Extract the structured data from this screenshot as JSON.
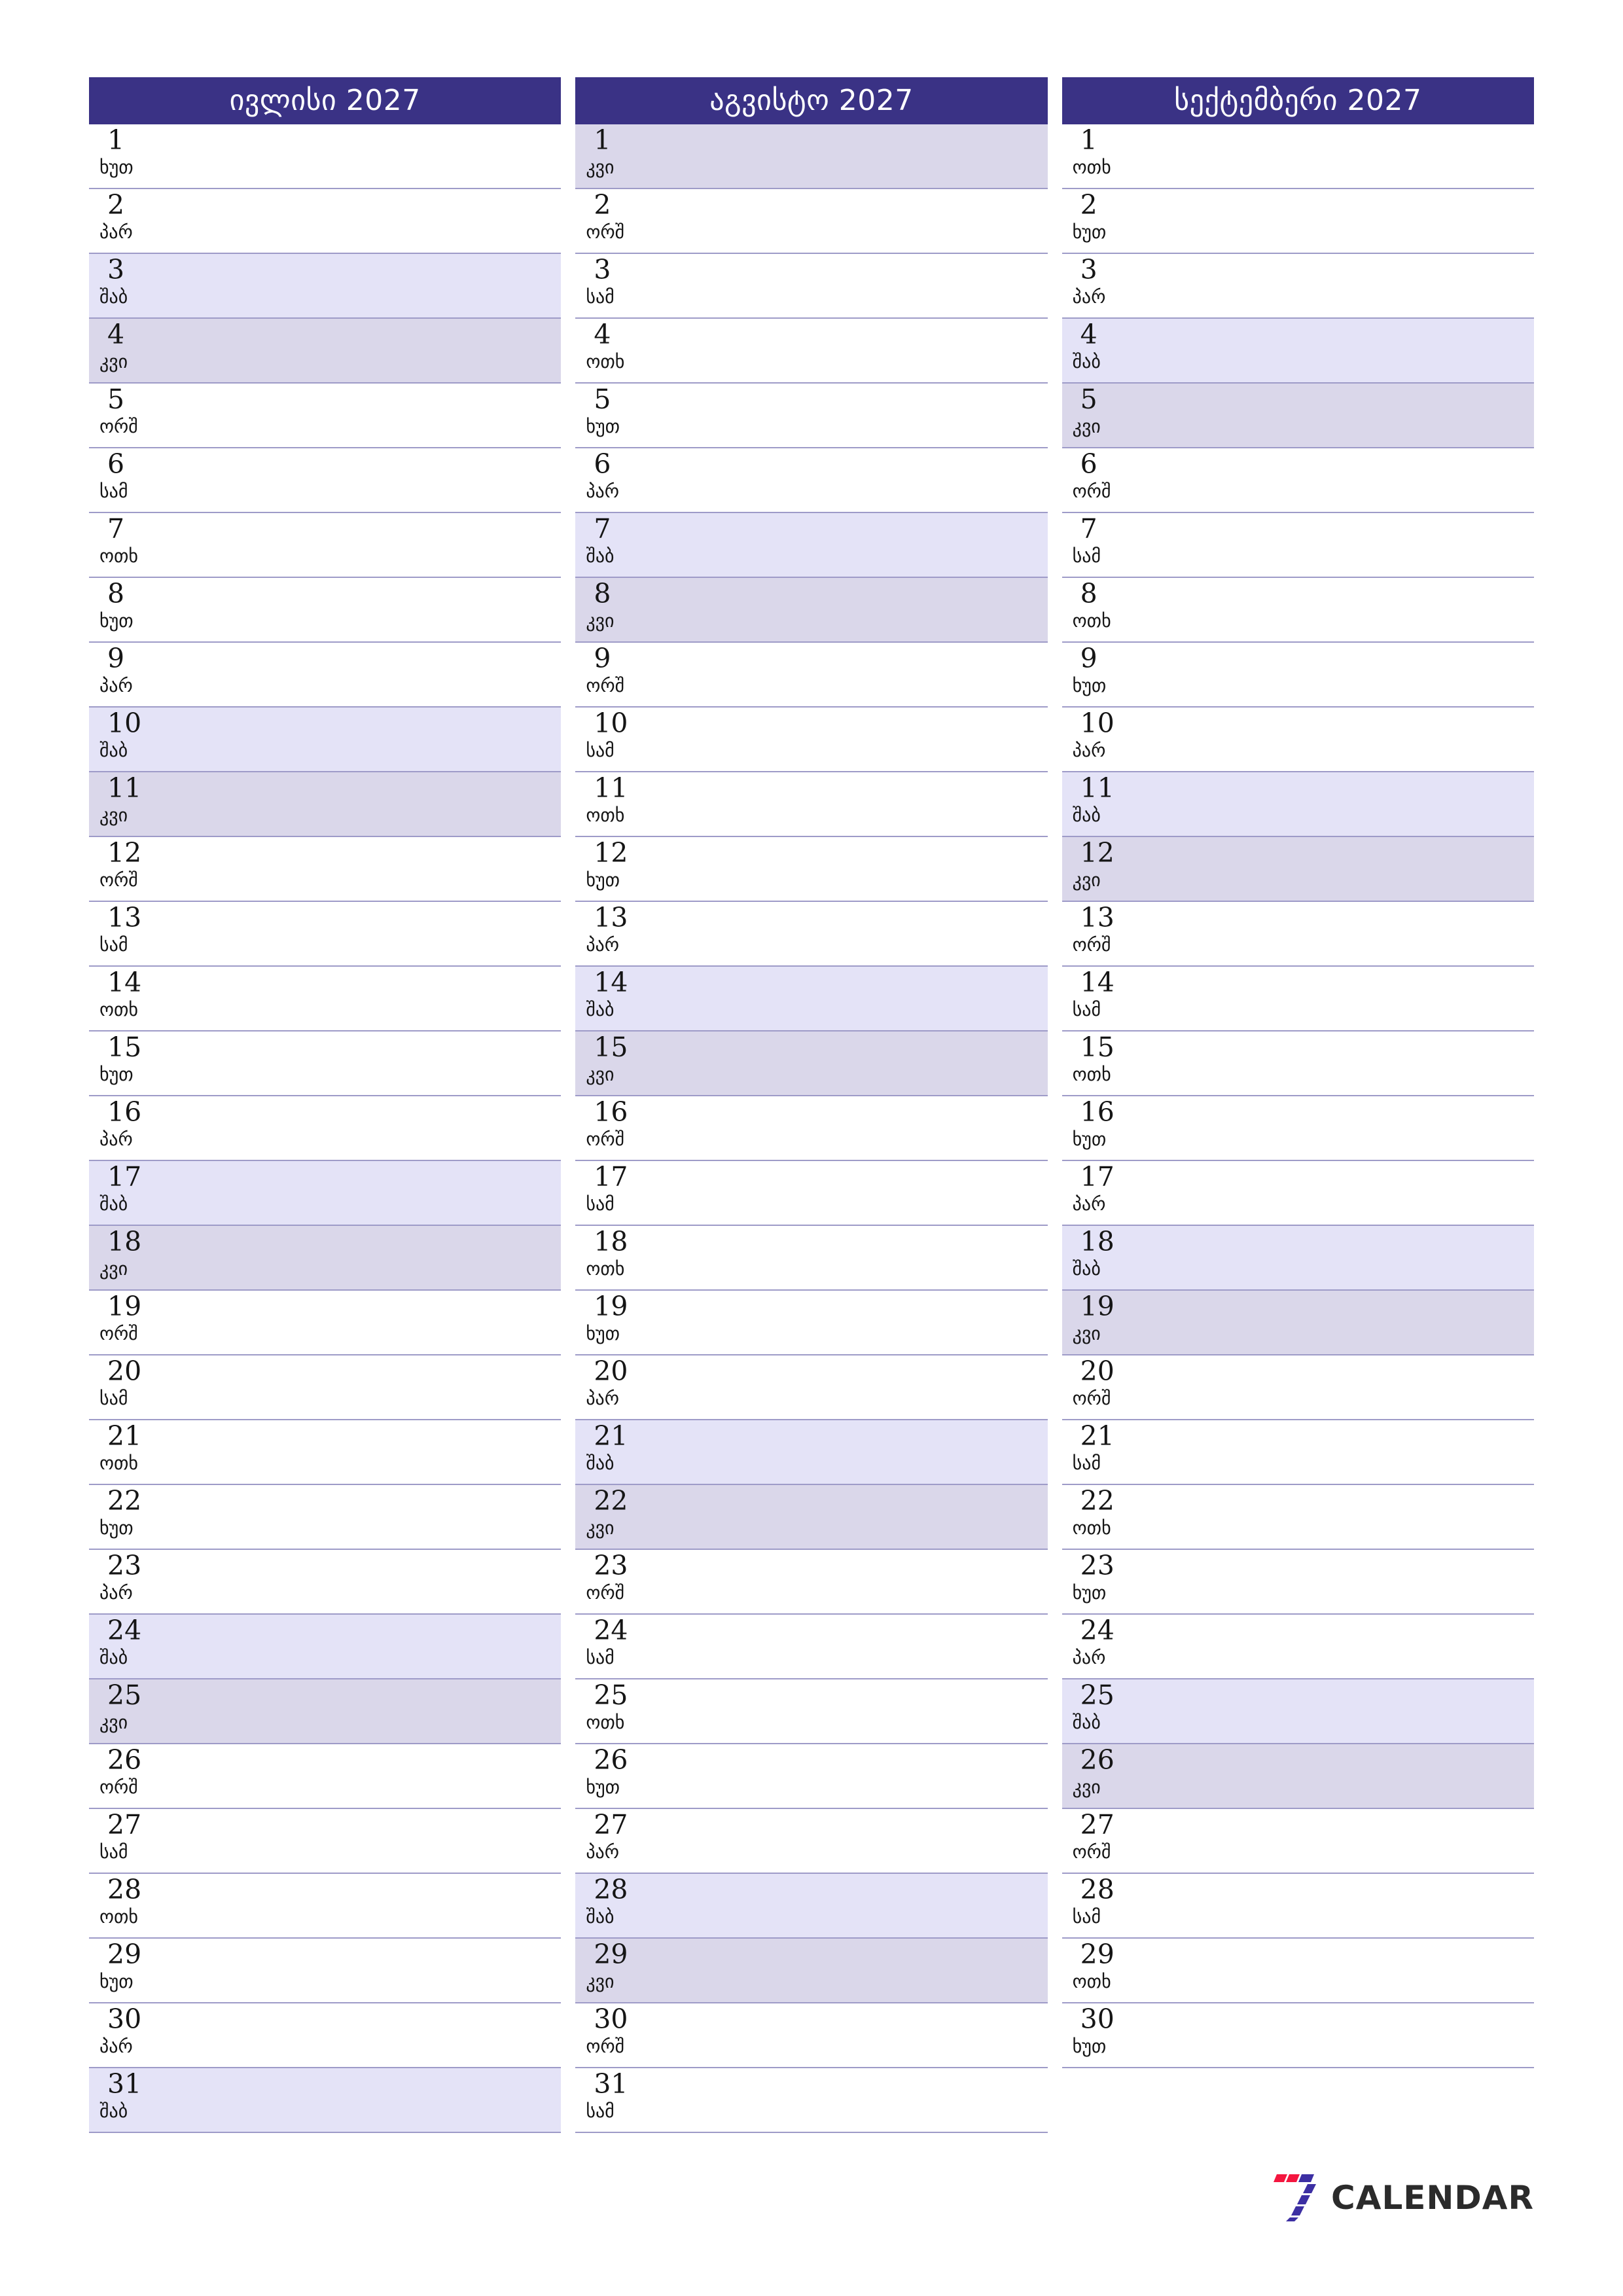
{
  "document": {
    "type": "quarterly-planner",
    "year": "2027",
    "language": "Georgian"
  },
  "colors": {
    "header_bg": "#3a3285",
    "header_text": "#ffffff",
    "saturday_bg": "#e4e3f7",
    "sunday_bg": "#dad7ea",
    "row_border": "#9e9bc8",
    "page_bg": "#ffffff",
    "logo_red": "#f4163f",
    "logo_purple": "#3c2fa3",
    "logo_text": "#2b2b2b"
  },
  "weekday_names": {
    "mon": "ორშ",
    "tue": "სამ",
    "wed": "ოთხ",
    "thu": "ხუთ",
    "fri": "პარ",
    "sat": "შაბ",
    "sun": "კვი"
  },
  "months": [
    {
      "title": "ივლისი 2027",
      "name": "ივლისი",
      "year": "2027",
      "days": [
        {
          "num": "1",
          "dow": "ხუთ",
          "type": "weekday"
        },
        {
          "num": "2",
          "dow": "პარ",
          "type": "weekday"
        },
        {
          "num": "3",
          "dow": "შაბ",
          "type": "sat"
        },
        {
          "num": "4",
          "dow": "კვი",
          "type": "sun"
        },
        {
          "num": "5",
          "dow": "ორშ",
          "type": "weekday"
        },
        {
          "num": "6",
          "dow": "სამ",
          "type": "weekday"
        },
        {
          "num": "7",
          "dow": "ოთხ",
          "type": "weekday"
        },
        {
          "num": "8",
          "dow": "ხუთ",
          "type": "weekday"
        },
        {
          "num": "9",
          "dow": "პარ",
          "type": "weekday"
        },
        {
          "num": "10",
          "dow": "შაბ",
          "type": "sat"
        },
        {
          "num": "11",
          "dow": "კვი",
          "type": "sun"
        },
        {
          "num": "12",
          "dow": "ორშ",
          "type": "weekday"
        },
        {
          "num": "13",
          "dow": "სამ",
          "type": "weekday"
        },
        {
          "num": "14",
          "dow": "ოთხ",
          "type": "weekday"
        },
        {
          "num": "15",
          "dow": "ხუთ",
          "type": "weekday"
        },
        {
          "num": "16",
          "dow": "პარ",
          "type": "weekday"
        },
        {
          "num": "17",
          "dow": "შაბ",
          "type": "sat"
        },
        {
          "num": "18",
          "dow": "კვი",
          "type": "sun"
        },
        {
          "num": "19",
          "dow": "ორშ",
          "type": "weekday"
        },
        {
          "num": "20",
          "dow": "სამ",
          "type": "weekday"
        },
        {
          "num": "21",
          "dow": "ოთხ",
          "type": "weekday"
        },
        {
          "num": "22",
          "dow": "ხუთ",
          "type": "weekday"
        },
        {
          "num": "23",
          "dow": "პარ",
          "type": "weekday"
        },
        {
          "num": "24",
          "dow": "შაბ",
          "type": "sat"
        },
        {
          "num": "25",
          "dow": "კვი",
          "type": "sun"
        },
        {
          "num": "26",
          "dow": "ორშ",
          "type": "weekday"
        },
        {
          "num": "27",
          "dow": "სამ",
          "type": "weekday"
        },
        {
          "num": "28",
          "dow": "ოთხ",
          "type": "weekday"
        },
        {
          "num": "29",
          "dow": "ხუთ",
          "type": "weekday"
        },
        {
          "num": "30",
          "dow": "პარ",
          "type": "weekday"
        },
        {
          "num": "31",
          "dow": "შაბ",
          "type": "sat"
        }
      ]
    },
    {
      "title": "აგვისტო 2027",
      "name": "აგვისტო",
      "year": "2027",
      "days": [
        {
          "num": "1",
          "dow": "კვი",
          "type": "sun"
        },
        {
          "num": "2",
          "dow": "ორშ",
          "type": "weekday"
        },
        {
          "num": "3",
          "dow": "სამ",
          "type": "weekday"
        },
        {
          "num": "4",
          "dow": "ოთხ",
          "type": "weekday"
        },
        {
          "num": "5",
          "dow": "ხუთ",
          "type": "weekday"
        },
        {
          "num": "6",
          "dow": "პარ",
          "type": "weekday"
        },
        {
          "num": "7",
          "dow": "შაბ",
          "type": "sat"
        },
        {
          "num": "8",
          "dow": "კვი",
          "type": "sun"
        },
        {
          "num": "9",
          "dow": "ორშ",
          "type": "weekday"
        },
        {
          "num": "10",
          "dow": "სამ",
          "type": "weekday"
        },
        {
          "num": "11",
          "dow": "ოთხ",
          "type": "weekday"
        },
        {
          "num": "12",
          "dow": "ხუთ",
          "type": "weekday"
        },
        {
          "num": "13",
          "dow": "პარ",
          "type": "weekday"
        },
        {
          "num": "14",
          "dow": "შაბ",
          "type": "sat"
        },
        {
          "num": "15",
          "dow": "კვი",
          "type": "sun"
        },
        {
          "num": "16",
          "dow": "ორშ",
          "type": "weekday"
        },
        {
          "num": "17",
          "dow": "სამ",
          "type": "weekday"
        },
        {
          "num": "18",
          "dow": "ოთხ",
          "type": "weekday"
        },
        {
          "num": "19",
          "dow": "ხუთ",
          "type": "weekday"
        },
        {
          "num": "20",
          "dow": "პარ",
          "type": "weekday"
        },
        {
          "num": "21",
          "dow": "შაბ",
          "type": "sat"
        },
        {
          "num": "22",
          "dow": "კვი",
          "type": "sun"
        },
        {
          "num": "23",
          "dow": "ორშ",
          "type": "weekday"
        },
        {
          "num": "24",
          "dow": "სამ",
          "type": "weekday"
        },
        {
          "num": "25",
          "dow": "ოთხ",
          "type": "weekday"
        },
        {
          "num": "26",
          "dow": "ხუთ",
          "type": "weekday"
        },
        {
          "num": "27",
          "dow": "პარ",
          "type": "weekday"
        },
        {
          "num": "28",
          "dow": "შაბ",
          "type": "sat"
        },
        {
          "num": "29",
          "dow": "კვი",
          "type": "sun"
        },
        {
          "num": "30",
          "dow": "ორშ",
          "type": "weekday"
        },
        {
          "num": "31",
          "dow": "სამ",
          "type": "weekday"
        }
      ]
    },
    {
      "title": "სექტემბერი 2027",
      "name": "სექტემბერი",
      "year": "2027",
      "days": [
        {
          "num": "1",
          "dow": "ოთხ",
          "type": "weekday"
        },
        {
          "num": "2",
          "dow": "ხუთ",
          "type": "weekday"
        },
        {
          "num": "3",
          "dow": "პარ",
          "type": "weekday"
        },
        {
          "num": "4",
          "dow": "შაბ",
          "type": "sat"
        },
        {
          "num": "5",
          "dow": "კვი",
          "type": "sun"
        },
        {
          "num": "6",
          "dow": "ორშ",
          "type": "weekday"
        },
        {
          "num": "7",
          "dow": "სამ",
          "type": "weekday"
        },
        {
          "num": "8",
          "dow": "ოთხ",
          "type": "weekday"
        },
        {
          "num": "9",
          "dow": "ხუთ",
          "type": "weekday"
        },
        {
          "num": "10",
          "dow": "პარ",
          "type": "weekday"
        },
        {
          "num": "11",
          "dow": "შაბ",
          "type": "sat"
        },
        {
          "num": "12",
          "dow": "კვი",
          "type": "sun"
        },
        {
          "num": "13",
          "dow": "ორშ",
          "type": "weekday"
        },
        {
          "num": "14",
          "dow": "სამ",
          "type": "weekday"
        },
        {
          "num": "15",
          "dow": "ოთხ",
          "type": "weekday"
        },
        {
          "num": "16",
          "dow": "ხუთ",
          "type": "weekday"
        },
        {
          "num": "17",
          "dow": "პარ",
          "type": "weekday"
        },
        {
          "num": "18",
          "dow": "შაბ",
          "type": "sat"
        },
        {
          "num": "19",
          "dow": "კვი",
          "type": "sun"
        },
        {
          "num": "20",
          "dow": "ორშ",
          "type": "weekday"
        },
        {
          "num": "21",
          "dow": "სამ",
          "type": "weekday"
        },
        {
          "num": "22",
          "dow": "ოთხ",
          "type": "weekday"
        },
        {
          "num": "23",
          "dow": "ხუთ",
          "type": "weekday"
        },
        {
          "num": "24",
          "dow": "პარ",
          "type": "weekday"
        },
        {
          "num": "25",
          "dow": "შაბ",
          "type": "sat"
        },
        {
          "num": "26",
          "dow": "კვი",
          "type": "sun"
        },
        {
          "num": "27",
          "dow": "ორშ",
          "type": "weekday"
        },
        {
          "num": "28",
          "dow": "სამ",
          "type": "weekday"
        },
        {
          "num": "29",
          "dow": "ოთხ",
          "type": "weekday"
        },
        {
          "num": "30",
          "dow": "ხუთ",
          "type": "weekday"
        }
      ]
    }
  ],
  "footer": {
    "logo_text": "CALENDAR",
    "logo_mark": "seven-logo-icon"
  }
}
